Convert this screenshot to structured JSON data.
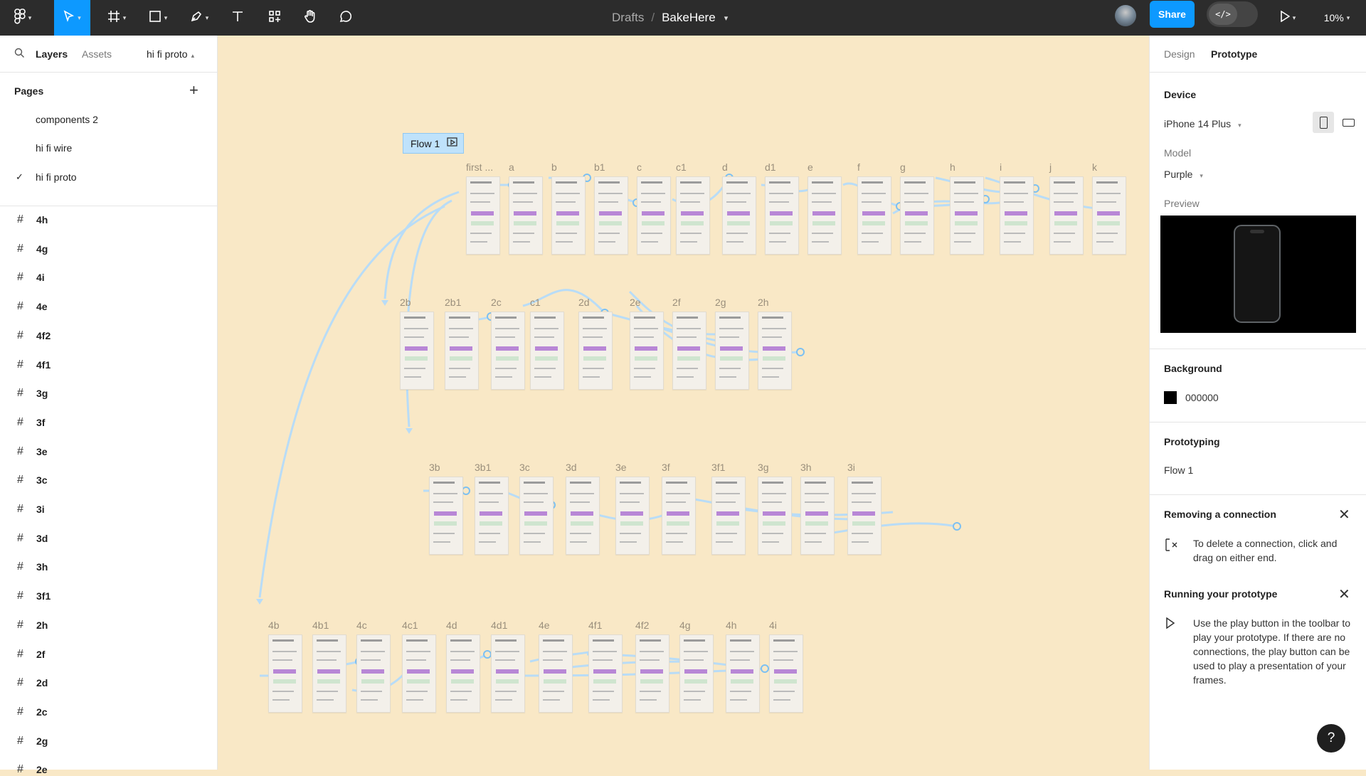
{
  "toolbar": {
    "breadcrumb_parent": "Drafts",
    "breadcrumb_sep": "/",
    "file_name": "BakeHere",
    "share_label": "Share",
    "zoom": "10%"
  },
  "left_panel": {
    "tab_layers": "Layers",
    "tab_assets": "Assets",
    "current_page": "hi fi proto",
    "pages_title": "Pages",
    "pages": [
      "components 2",
      "hi fi wire",
      "hi fi proto"
    ],
    "layers": [
      "4h",
      "4g",
      "4i",
      "4e",
      "4f2",
      "4f1",
      "3g",
      "3f",
      "3e",
      "3c",
      "3i",
      "3d",
      "3h",
      "3f1",
      "2h",
      "2f",
      "2d",
      "2c",
      "2g",
      "2e"
    ]
  },
  "canvas": {
    "flow_label": "Flow 1",
    "frame_labels": [
      "first ...",
      "a",
      "b",
      "b1",
      "c",
      "c1",
      "d",
      "d1",
      "e",
      "f",
      "g",
      "h",
      "i",
      "j",
      "k",
      "2b",
      "2b1",
      "2c",
      "c1",
      "2d",
      "2e",
      "2f",
      "2g",
      "2h",
      "3b",
      "3b1",
      "3c",
      "3d",
      "3e",
      "3f",
      "3f1",
      "3g",
      "3h",
      "3i",
      "4b",
      "4b1",
      "4c",
      "4c1",
      "4d",
      "4d1",
      "4e",
      "4f1",
      "4f2",
      "4g",
      "4h",
      "4i"
    ]
  },
  "right_panel": {
    "tab_design": "Design",
    "tab_prototype": "Prototype",
    "device_title": "Device",
    "device_value": "iPhone 14 Plus",
    "model_label": "Model",
    "model_value": "Purple",
    "preview_label": "Preview",
    "background_title": "Background",
    "background_hex": "000000",
    "background_color": "#000000",
    "prototyping_title": "Prototyping",
    "flow_name": "Flow 1",
    "removing_title": "Removing a connection",
    "removing_text": "To delete a connection, click and drag on either end.",
    "running_title": "Running your prototype",
    "running_text": "Use the play button in the toolbar to play your prototype. If there are no connections, the play button can be used to play a presentation of your frames.",
    "help": "?"
  },
  "colors": {
    "accent": "#0d99ff",
    "canvas_bg": "#f9e8c6",
    "connector": "#b8dcf7"
  }
}
